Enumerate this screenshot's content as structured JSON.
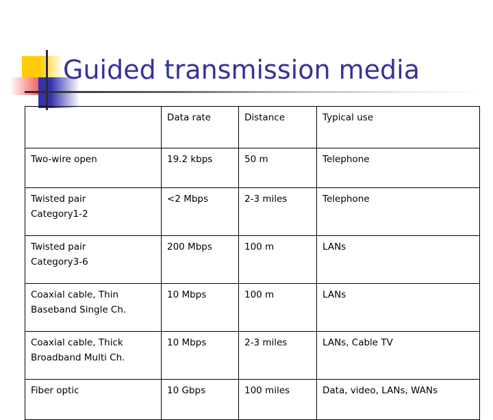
{
  "slide": {
    "title": "Guided transmission media",
    "decoration": {
      "yellow": "#FFCB05",
      "red": "#F6413A",
      "blue": "#3333AD",
      "line": "#2B2B33"
    },
    "title_color": "#333399"
  },
  "table": {
    "headers": [
      "",
      "Data rate",
      "Distance",
      "Typical use"
    ],
    "rows": [
      {
        "medium": [
          "Two-wire open"
        ],
        "data_rate": "19.2 kbps",
        "distance": "50 m",
        "typical_use": "Telephone"
      },
      {
        "medium": [
          "Twisted pair",
          "Category1-2"
        ],
        "data_rate": "<2 Mbps",
        "distance": "2-3 miles",
        "typical_use": "Telephone"
      },
      {
        "medium": [
          "Twisted pair",
          "Category3-6"
        ],
        "data_rate": "200 Mbps",
        "distance": "100 m",
        "typical_use": "LANs"
      },
      {
        "medium": [
          "Coaxial cable, Thin",
          "Baseband Single Ch."
        ],
        "data_rate": "10 Mbps",
        "distance": "100 m",
        "typical_use": "LANs"
      },
      {
        "medium": [
          "Coaxial cable, Thick",
          "Broadband Multi Ch."
        ],
        "data_rate": "10 Mbps",
        "distance": "2-3 miles",
        "typical_use": "LANs, Cable TV"
      },
      {
        "medium": [
          "Fiber optic"
        ],
        "data_rate": "10 Gbps",
        "distance": "100 miles",
        "typical_use": "Data, video, LANs, WANs"
      }
    ]
  }
}
